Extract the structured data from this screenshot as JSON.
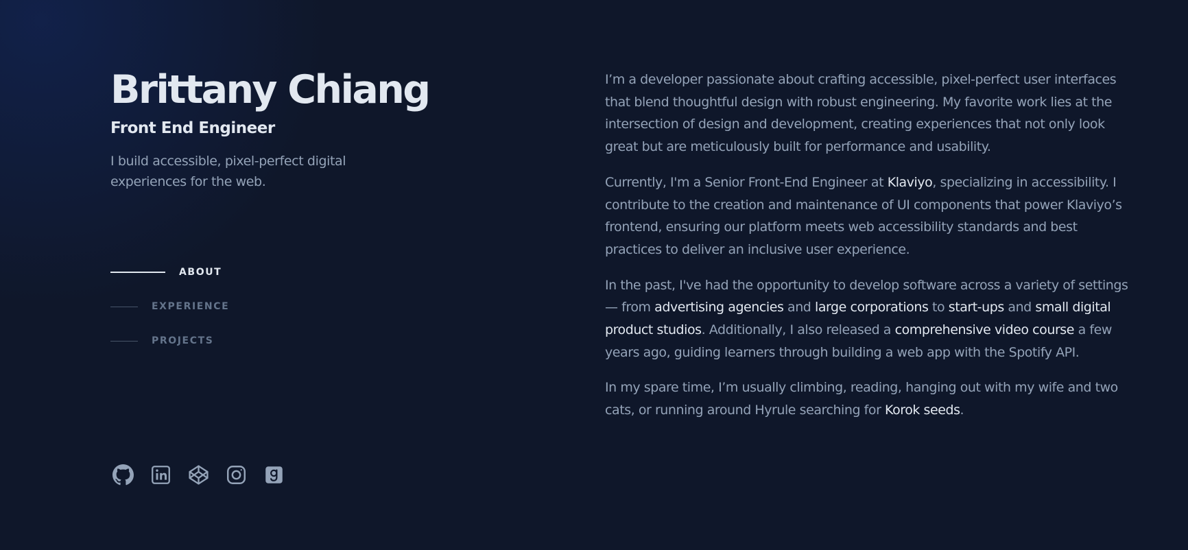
{
  "header": {
    "name": "Brittany Chiang",
    "role": "Front End Engineer",
    "tagline": "I build accessible, pixel-perfect digital experiences for the web."
  },
  "nav": {
    "items": [
      {
        "label": "ABOUT",
        "active": true
      },
      {
        "label": "EXPERIENCE",
        "active": false
      },
      {
        "label": "PROJECTS",
        "active": false
      }
    ]
  },
  "socials": [
    {
      "icon": "github-icon"
    },
    {
      "icon": "linkedin-icon"
    },
    {
      "icon": "codepen-icon"
    },
    {
      "icon": "instagram-icon"
    },
    {
      "icon": "goodreads-icon"
    }
  ],
  "about": {
    "p1": "I’m a developer passionate about crafting accessible, pixel-perfect user interfaces that blend thoughtful design with robust engineering. My favorite work lies at the intersection of design and development, creating experiences that not only look great but are meticulously built for performance and usability.",
    "p2": {
      "t1": "Currently, I'm a Senior Front-End Engineer at ",
      "link_klaviyo": "Klaviyo",
      "t2": ", specializing in accessibility. I contribute to the creation and maintenance of UI components that power Klaviyo’s frontend, ensuring our platform meets web accessibility standards and best practices to deliver an inclusive user experience."
    },
    "p3": {
      "t1": "In the past, I've had the opportunity to develop software across a variety of settings — from ",
      "link_agencies": "advertising agencies",
      "t2": " and ",
      "link_corporations": "large corporations",
      "t3": " to ",
      "link_startups": "start-ups",
      "t4": " and ",
      "link_studios": "small digital product studios",
      "t5": ". Additionally, I also released a ",
      "link_course": "comprehensive video course",
      "t6": " a few years ago, guiding learners through building a web app with the Spotify API."
    },
    "p4": {
      "t1": "In my spare time, I’m usually climbing, reading, hanging out with my wife and two cats, or running around Hyrule searching for ",
      "link_korok": "Korok seeds",
      "t2": "."
    }
  },
  "colors": {
    "background": "#0f172a",
    "heading": "#e2e8f0",
    "body": "#94a3b8",
    "muted": "#64748b"
  }
}
